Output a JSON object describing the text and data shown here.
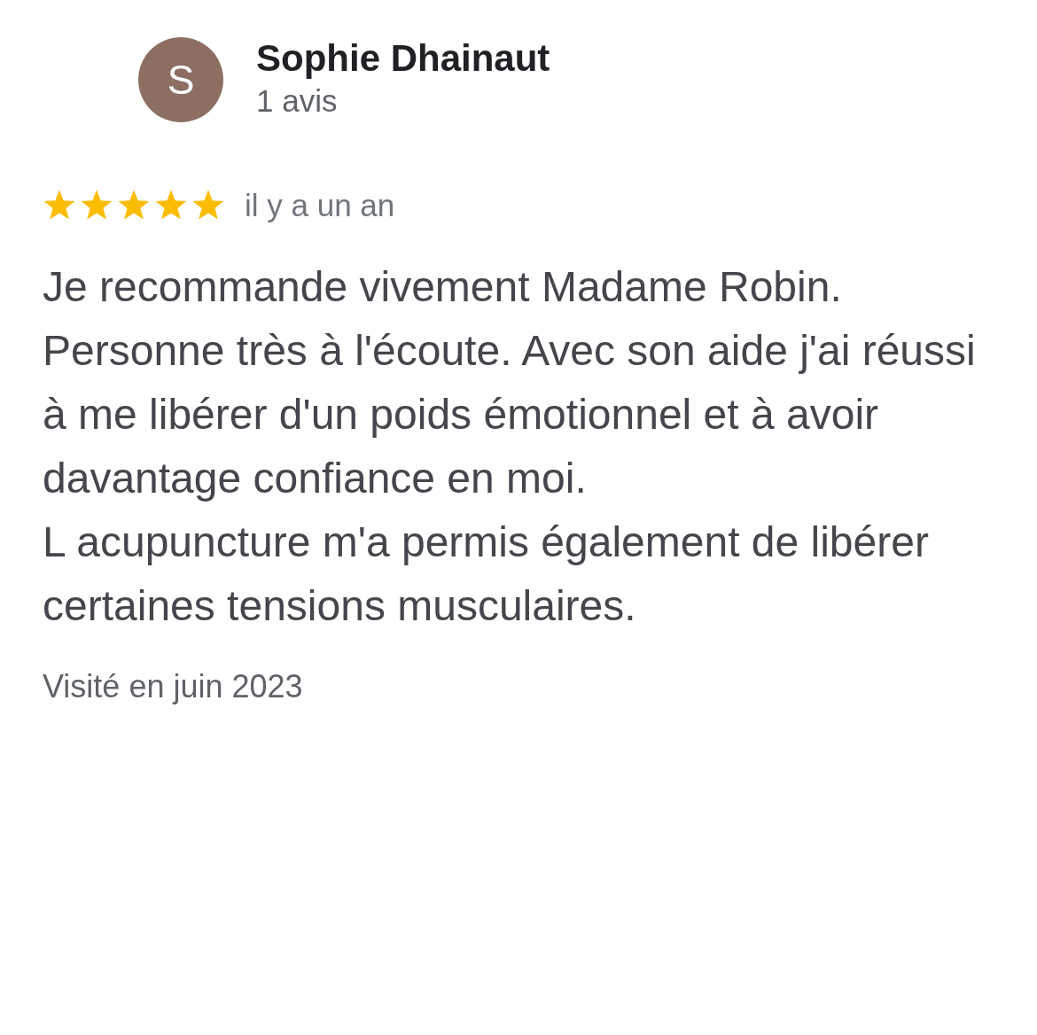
{
  "reviewer": {
    "initial": "S",
    "name": "Sophie Dhainaut",
    "review_count": "1 avis"
  },
  "review": {
    "stars": 5,
    "time": "il y a un an",
    "paragraphs": [
      "Je recommande vivement Madame Robin. Personne très à l'écoute. Avec son aide j'ai réussi à me libérer d'un poids émotionnel et à avoir davantage confiance en moi.",
      "L acupuncture m'a permis également de libérer certaines tensions musculaires."
    ],
    "visit": "Visité en juin 2023"
  }
}
